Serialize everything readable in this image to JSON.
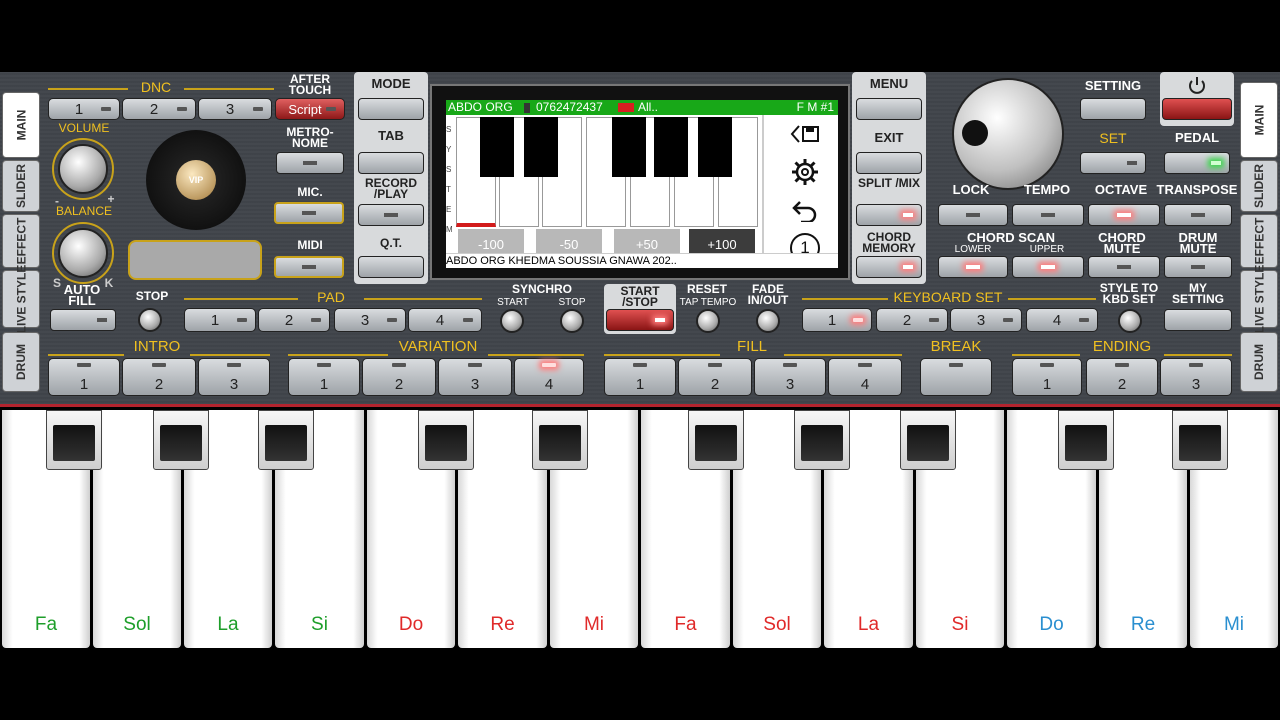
{
  "side_tabs_left": [
    "MAIN",
    "SLIDER",
    "EFFECT",
    "LIVE STYLE",
    "DRUM"
  ],
  "side_tabs_right": [
    "MAIN",
    "SLIDER",
    "EFFECT",
    "LIVE STYLE",
    "DRUM"
  ],
  "dnc": {
    "title": "DNC",
    "buttons": [
      "1",
      "2",
      "3"
    ],
    "script": "Script"
  },
  "after_touch": "AFTER TOUCH",
  "volume": "VOLUME",
  "balance": "BALANCE",
  "minus": "-",
  "plus": "+",
  "s_label": "S",
  "k_label": "K",
  "vip_label": "VIP",
  "metronome": "METRO- NOME",
  "mic": "MIC.",
  "midi": "MIDI",
  "col_buttons": {
    "mode": "MODE",
    "tab": "TAB",
    "record": "RECORD /PLAY",
    "qt": "Q.T."
  },
  "screen": {
    "header_left": "ABDO ORG",
    "header_phone": "0762472437",
    "header_all": "All..",
    "header_right": "F M #1",
    "side_letters": "S Y S T E M",
    "offsets": [
      "-100",
      "-50",
      "+50",
      "+100"
    ],
    "footer": "ABDO ORG KHEDMA SOUSSIA GNAWA 202..",
    "icons": [
      "save-icon",
      "gear-icon",
      "undo-icon",
      "number-one-icon"
    ],
    "icon_one": "1"
  },
  "right_col": {
    "menu": "MENU",
    "exit": "EXIT",
    "split": "SPLIT /MIX",
    "chord_memory": "CHORD MEMORY"
  },
  "right_area": {
    "setting": "SETTING",
    "set": "SET",
    "pedal": "PEDAL",
    "lock": "LOCK",
    "tempo": "TEMPO",
    "octave": "OCTAVE",
    "transpose": "TRANSPOSE",
    "chord_scan": "CHORD SCAN",
    "lower": "LOWER",
    "upper": "UPPER",
    "chord_mute": "CHORD MUTE",
    "drum_mute": "DRUM MUTE"
  },
  "row3": {
    "auto_fill": "AUTO FILL",
    "stop": "STOP",
    "pad": "PAD",
    "pad_buttons": [
      "1",
      "2",
      "3",
      "4"
    ],
    "synchro": "SYNCHRO",
    "sync_start": "START",
    "sync_stop": "STOP",
    "start_stop": "START /STOP",
    "reset": "RESET",
    "tap_tempo": "TAP TEMPO",
    "fade": "FADE IN/OUT",
    "keyboard_set": "KEYBOARD SET",
    "kbd_buttons": [
      "1",
      "2",
      "3",
      "4"
    ],
    "style_to_kbd": "STYLE TO KBD SET",
    "my_setting": "MY SETTING"
  },
  "row4": {
    "intro": "INTRO",
    "intro_buttons": [
      "1",
      "2",
      "3"
    ],
    "variation": "VARIATION",
    "variation_buttons": [
      "1",
      "2",
      "3",
      "4"
    ],
    "fill": "FILL",
    "fill_buttons": [
      "1",
      "2",
      "3",
      "4"
    ],
    "break": "BREAK",
    "ending": "ENDING",
    "ending_buttons": [
      "1",
      "2",
      "3"
    ]
  },
  "keyboard": {
    "notes": [
      {
        "label": "Fa",
        "color": "#1e9e2a"
      },
      {
        "label": "Sol",
        "color": "#1e9e2a"
      },
      {
        "label": "La",
        "color": "#1e9e2a"
      },
      {
        "label": "Si",
        "color": "#1e9e2a"
      },
      {
        "label": "Do",
        "color": "#e02a2a"
      },
      {
        "label": "Re",
        "color": "#e02a2a"
      },
      {
        "label": "Mi",
        "color": "#e02a2a"
      },
      {
        "label": "Fa",
        "color": "#e02a2a"
      },
      {
        "label": "Sol",
        "color": "#e02a2a"
      },
      {
        "label": "La",
        "color": "#e02a2a"
      },
      {
        "label": "Si",
        "color": "#e02a2a"
      },
      {
        "label": "Do",
        "color": "#2a8fd0"
      },
      {
        "label": "Re",
        "color": "#2a8fd0"
      },
      {
        "label": "Mi",
        "color": "#2a8fd0"
      }
    ]
  },
  "colors": {
    "accent_gold": "#c8a21a",
    "screen_green": "#18a818",
    "key_separator": "#b3242e"
  }
}
